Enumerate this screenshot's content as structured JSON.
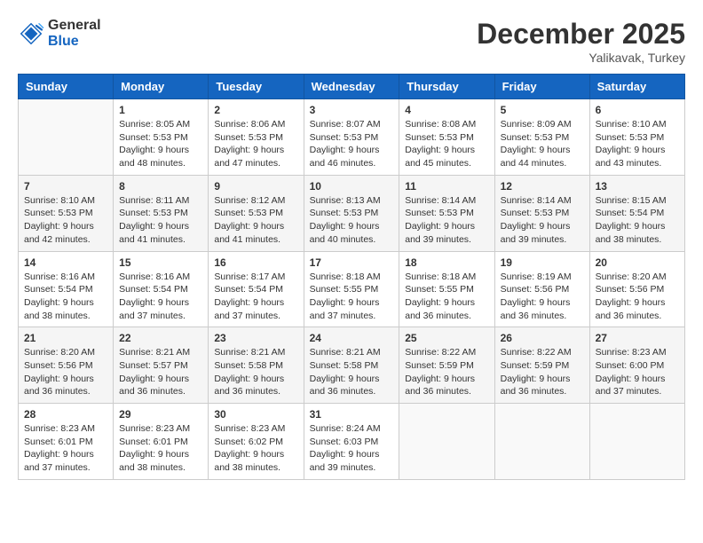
{
  "header": {
    "logo_general": "General",
    "logo_blue": "Blue",
    "month_title": "December 2025",
    "location": "Yalikavak, Turkey"
  },
  "days_of_week": [
    "Sunday",
    "Monday",
    "Tuesday",
    "Wednesday",
    "Thursday",
    "Friday",
    "Saturday"
  ],
  "weeks": [
    [
      {
        "day": "",
        "info": ""
      },
      {
        "day": "1",
        "sunrise": "8:05 AM",
        "sunset": "5:53 PM",
        "daylight": "9 hours and 48 minutes."
      },
      {
        "day": "2",
        "sunrise": "8:06 AM",
        "sunset": "5:53 PM",
        "daylight": "9 hours and 47 minutes."
      },
      {
        "day": "3",
        "sunrise": "8:07 AM",
        "sunset": "5:53 PM",
        "daylight": "9 hours and 46 minutes."
      },
      {
        "day": "4",
        "sunrise": "8:08 AM",
        "sunset": "5:53 PM",
        "daylight": "9 hours and 45 minutes."
      },
      {
        "day": "5",
        "sunrise": "8:09 AM",
        "sunset": "5:53 PM",
        "daylight": "9 hours and 44 minutes."
      },
      {
        "day": "6",
        "sunrise": "8:10 AM",
        "sunset": "5:53 PM",
        "daylight": "9 hours and 43 minutes."
      }
    ],
    [
      {
        "day": "7",
        "sunrise": "8:10 AM",
        "sunset": "5:53 PM",
        "daylight": "9 hours and 42 minutes."
      },
      {
        "day": "8",
        "sunrise": "8:11 AM",
        "sunset": "5:53 PM",
        "daylight": "9 hours and 41 minutes."
      },
      {
        "day": "9",
        "sunrise": "8:12 AM",
        "sunset": "5:53 PM",
        "daylight": "9 hours and 41 minutes."
      },
      {
        "day": "10",
        "sunrise": "8:13 AM",
        "sunset": "5:53 PM",
        "daylight": "9 hours and 40 minutes."
      },
      {
        "day": "11",
        "sunrise": "8:14 AM",
        "sunset": "5:53 PM",
        "daylight": "9 hours and 39 minutes."
      },
      {
        "day": "12",
        "sunrise": "8:14 AM",
        "sunset": "5:53 PM",
        "daylight": "9 hours and 39 minutes."
      },
      {
        "day": "13",
        "sunrise": "8:15 AM",
        "sunset": "5:54 PM",
        "daylight": "9 hours and 38 minutes."
      }
    ],
    [
      {
        "day": "14",
        "sunrise": "8:16 AM",
        "sunset": "5:54 PM",
        "daylight": "9 hours and 38 minutes."
      },
      {
        "day": "15",
        "sunrise": "8:16 AM",
        "sunset": "5:54 PM",
        "daylight": "9 hours and 37 minutes."
      },
      {
        "day": "16",
        "sunrise": "8:17 AM",
        "sunset": "5:54 PM",
        "daylight": "9 hours and 37 minutes."
      },
      {
        "day": "17",
        "sunrise": "8:18 AM",
        "sunset": "5:55 PM",
        "daylight": "9 hours and 37 minutes."
      },
      {
        "day": "18",
        "sunrise": "8:18 AM",
        "sunset": "5:55 PM",
        "daylight": "9 hours and 36 minutes."
      },
      {
        "day": "19",
        "sunrise": "8:19 AM",
        "sunset": "5:56 PM",
        "daylight": "9 hours and 36 minutes."
      },
      {
        "day": "20",
        "sunrise": "8:20 AM",
        "sunset": "5:56 PM",
        "daylight": "9 hours and 36 minutes."
      }
    ],
    [
      {
        "day": "21",
        "sunrise": "8:20 AM",
        "sunset": "5:56 PM",
        "daylight": "9 hours and 36 minutes."
      },
      {
        "day": "22",
        "sunrise": "8:21 AM",
        "sunset": "5:57 PM",
        "daylight": "9 hours and 36 minutes."
      },
      {
        "day": "23",
        "sunrise": "8:21 AM",
        "sunset": "5:58 PM",
        "daylight": "9 hours and 36 minutes."
      },
      {
        "day": "24",
        "sunrise": "8:21 AM",
        "sunset": "5:58 PM",
        "daylight": "9 hours and 36 minutes."
      },
      {
        "day": "25",
        "sunrise": "8:22 AM",
        "sunset": "5:59 PM",
        "daylight": "9 hours and 36 minutes."
      },
      {
        "day": "26",
        "sunrise": "8:22 AM",
        "sunset": "5:59 PM",
        "daylight": "9 hours and 36 minutes."
      },
      {
        "day": "27",
        "sunrise": "8:23 AM",
        "sunset": "6:00 PM",
        "daylight": "9 hours and 37 minutes."
      }
    ],
    [
      {
        "day": "28",
        "sunrise": "8:23 AM",
        "sunset": "6:01 PM",
        "daylight": "9 hours and 37 minutes."
      },
      {
        "day": "29",
        "sunrise": "8:23 AM",
        "sunset": "6:01 PM",
        "daylight": "9 hours and 38 minutes."
      },
      {
        "day": "30",
        "sunrise": "8:23 AM",
        "sunset": "6:02 PM",
        "daylight": "9 hours and 38 minutes."
      },
      {
        "day": "31",
        "sunrise": "8:24 AM",
        "sunset": "6:03 PM",
        "daylight": "9 hours and 39 minutes."
      },
      {
        "day": "",
        "info": ""
      },
      {
        "day": "",
        "info": ""
      },
      {
        "day": "",
        "info": ""
      }
    ]
  ],
  "labels": {
    "sunrise": "Sunrise:",
    "sunset": "Sunset:",
    "daylight": "Daylight:"
  }
}
